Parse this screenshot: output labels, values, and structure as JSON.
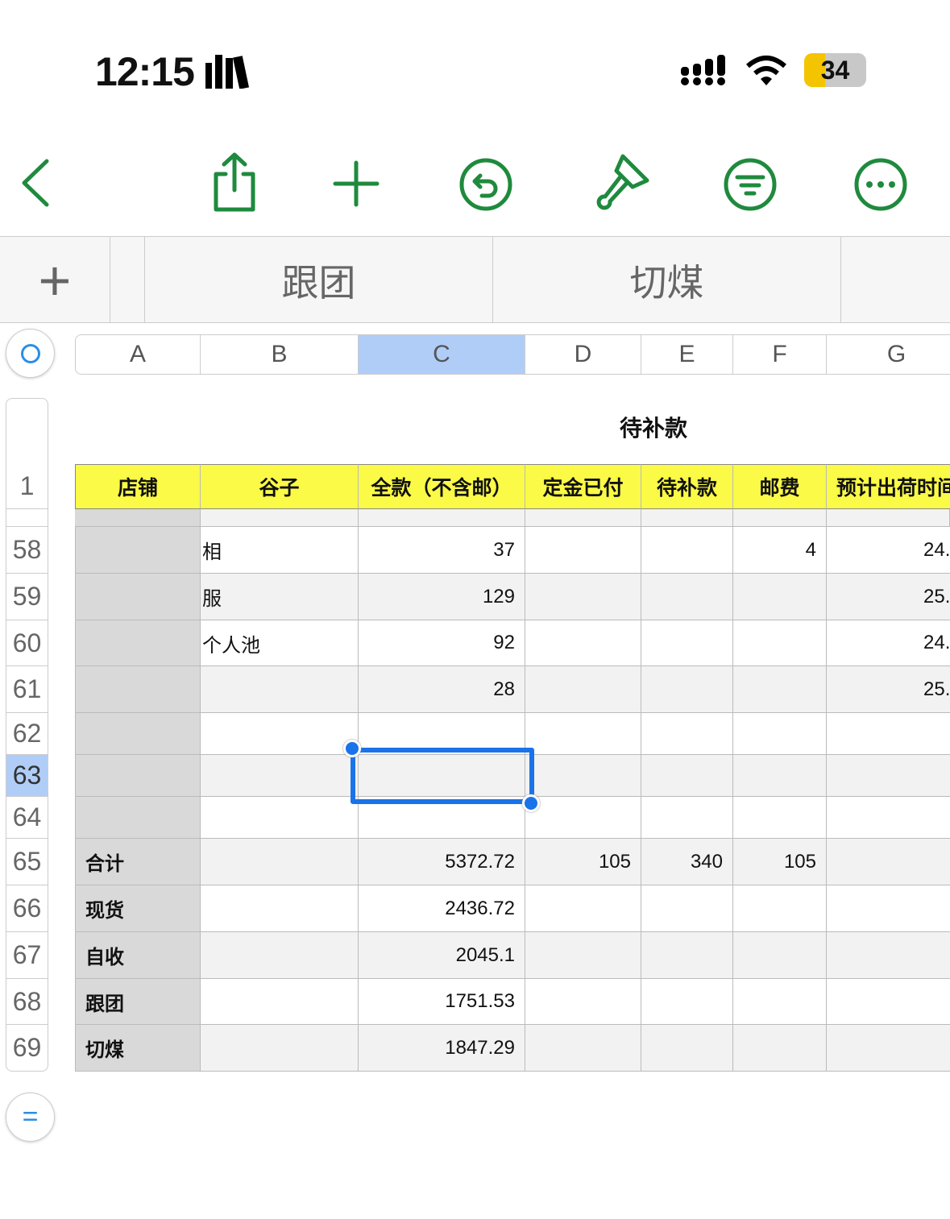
{
  "status_bar": {
    "time": "12:15",
    "battery": "34",
    "battery_level": 34
  },
  "toolbar": {
    "icons": [
      "back-icon",
      "share-icon",
      "add-icon",
      "undo-icon",
      "format-brush-icon",
      "filter-icon",
      "more-icon"
    ]
  },
  "sheet_tabs": {
    "add": "+",
    "tabs": [
      "跟团",
      "切煤"
    ]
  },
  "columns": [
    "A",
    "B",
    "C",
    "D",
    "E",
    "F",
    "G"
  ],
  "selected_column": "C",
  "table_title": "待补款",
  "header_row": {
    "row": "1",
    "cells": [
      "店铺",
      "谷子",
      "全款（不含邮）",
      "定金已付",
      "待补款",
      "邮费",
      "预计出荷时间"
    ]
  },
  "rows": [
    {
      "row": "58",
      "cells": [
        "",
        "相",
        "37",
        "",
        "",
        "4",
        "24."
      ]
    },
    {
      "row": "59",
      "cells": [
        "",
        "服",
        "129",
        "",
        "",
        "",
        "25."
      ]
    },
    {
      "row": "60",
      "cells": [
        "",
        "个人池",
        "92",
        "",
        "",
        "",
        "24."
      ]
    },
    {
      "row": "61",
      "cells": [
        "",
        "",
        "28",
        "",
        "",
        "",
        "25."
      ]
    },
    {
      "row": "62",
      "cells": [
        "",
        "",
        "",
        "",
        "",
        "",
        ""
      ]
    },
    {
      "row": "63",
      "cells": [
        "",
        "",
        "",
        "",
        "",
        "",
        ""
      ]
    },
    {
      "row": "64",
      "cells": [
        "",
        "",
        "",
        "",
        "",
        "",
        ""
      ]
    },
    {
      "row": "65",
      "cells": [
        "合计",
        "",
        "5372.72",
        "105",
        "340",
        "105",
        ""
      ]
    },
    {
      "row": "66",
      "cells": [
        "现货",
        "",
        "2436.72",
        "",
        "",
        "",
        ""
      ]
    },
    {
      "row": "67",
      "cells": [
        "自收",
        "",
        "2045.1",
        "",
        "",
        "",
        ""
      ]
    },
    {
      "row": "68",
      "cells": [
        "跟团",
        "",
        "1751.53",
        "",
        "",
        "",
        ""
      ]
    },
    {
      "row": "69",
      "cells": [
        "切煤",
        "",
        "1847.29",
        "",
        "",
        "",
        ""
      ]
    }
  ],
  "selected_row": "63",
  "selected_cell": "C63",
  "colors": {
    "accent": "#1f8a3d",
    "header_fill": "#fafa47",
    "selection": "#1a73e8",
    "frozen_col": "#d9d9d9"
  }
}
